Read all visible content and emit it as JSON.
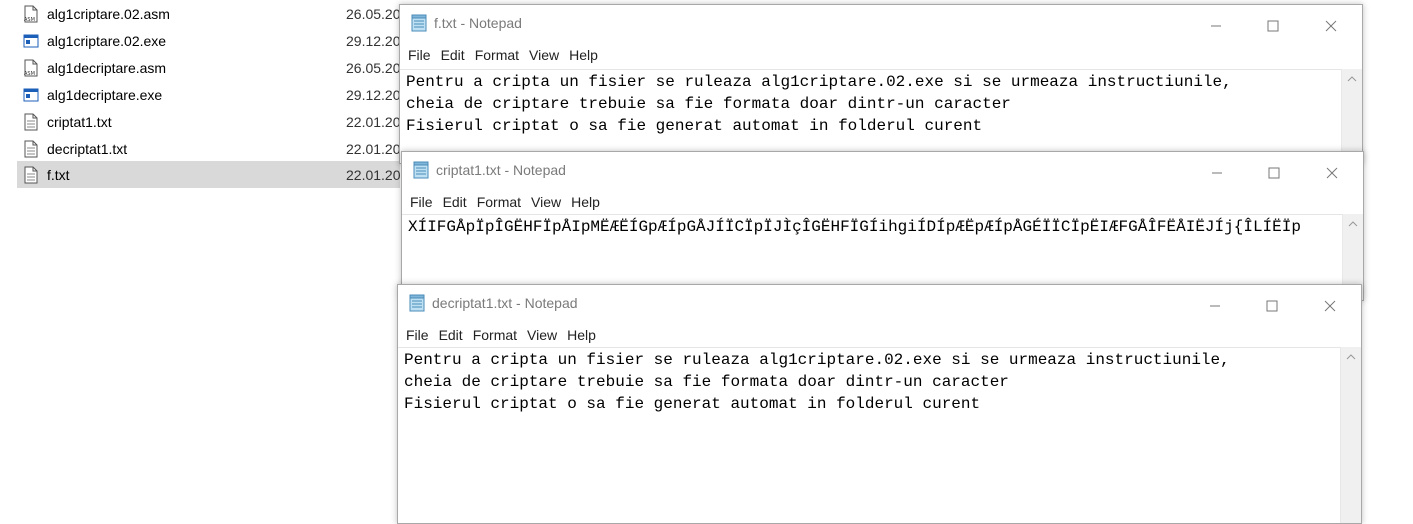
{
  "explorer": {
    "files": [
      {
        "name": "alg1criptare.02.asm",
        "date": "26.05.20",
        "icon": "asm-file-icon"
      },
      {
        "name": "alg1criptare.02.exe",
        "date": "29.12.20",
        "icon": "exe-file-icon"
      },
      {
        "name": "alg1decriptare.asm",
        "date": "26.05.20",
        "icon": "asm-file-icon"
      },
      {
        "name": "alg1decriptare.exe",
        "date": "29.12.20",
        "icon": "exe-file-icon"
      },
      {
        "name": "criptat1.txt",
        "date": "22.01.20",
        "icon": "text-file-icon"
      },
      {
        "name": "decriptat1.txt",
        "date": "22.01.20",
        "icon": "text-file-icon"
      },
      {
        "name": "f.txt",
        "date": "22.01.20",
        "icon": "text-file-icon",
        "selected": true
      }
    ]
  },
  "menu": {
    "file": "File",
    "edit": "Edit",
    "format": "Format",
    "view": "View",
    "help": "Help"
  },
  "windows": {
    "f": {
      "title": "f.txt - Notepad",
      "content": "Pentru a cripta un fisier se ruleaza alg1criptare.02.exe si se urmeaza instructiunile,\ncheia de criptare trebuie sa fie formata doar dintr-un caracter\nFisierul criptat o sa fie generat automat in folderul curent"
    },
    "criptat": {
      "title": "criptat1.txt - Notepad",
      "content": "XÍIFGÅpÏpÎGËHFÏpÅIpMËÆËÍGpÆÍpGÅJÍÏCÏpÏJÌçÎGËHFÏGÍihgiÍDÍpÆËpÆÍpÅGÉÏÏCÏpËIÆFGÅÎFËÅIËJÍj{ÎLÍËÏp"
    },
    "decriptat": {
      "title": "decriptat1.txt - Notepad",
      "content": "Pentru a cripta un fisier se ruleaza alg1criptare.02.exe si se urmeaza instructiunile,\ncheia de criptare trebuie sa fie formata doar dintr-un caracter\nFisierul criptat o sa fie generat automat in folderul curent"
    }
  },
  "colors": {
    "title_inactive": "#7a7a7a",
    "selection": "#d9d9d9",
    "border": "#a8a8a8"
  }
}
